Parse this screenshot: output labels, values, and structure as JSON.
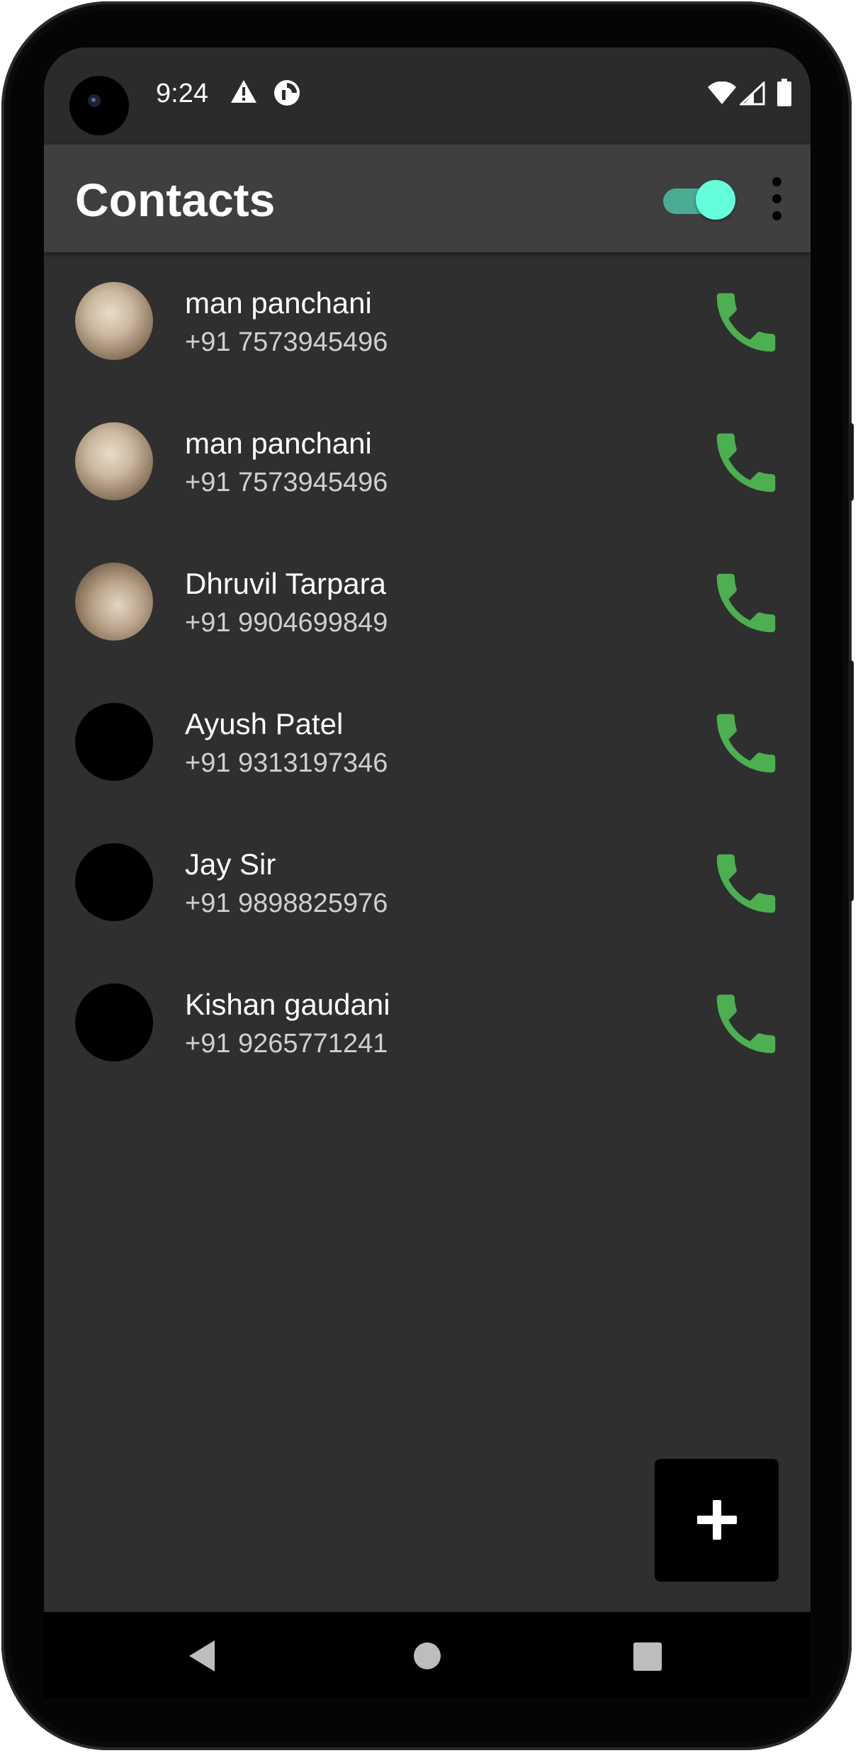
{
  "status_bar": {
    "time": "9:24",
    "icons": [
      "warning-icon",
      "data-saver-icon",
      "wifi-icon",
      "signal-icon",
      "battery-icon"
    ]
  },
  "app_bar": {
    "title": "Contacts",
    "toggle_on": true,
    "menu_icon": "more-vert-icon"
  },
  "contacts": [
    {
      "name": "man panchani",
      "phone": "+91 7573945496",
      "avatar": "photo"
    },
    {
      "name": "man panchani",
      "phone": "+91 7573945496",
      "avatar": "photo"
    },
    {
      "name": "Dhruvil Tarpara",
      "phone": "+91 9904699849",
      "avatar": "photo"
    },
    {
      "name": "Ayush Patel",
      "phone": "+91 9313197346",
      "avatar": "blank"
    },
    {
      "name": "Jay Sir",
      "phone": "+91 9898825976",
      "avatar": "blank"
    },
    {
      "name": "Kishan gaudani",
      "phone": "+91 9265771241",
      "avatar": "blank"
    }
  ],
  "fab_icon": "add-icon",
  "nav": [
    "back-icon",
    "home-icon",
    "recents-icon"
  ],
  "colors": {
    "background": "#2f2f2f",
    "app_bar": "#3f3f3f",
    "call_icon": "#4caf50",
    "toggle_knob": "#64ffda",
    "toggle_track": "#4bab93"
  }
}
